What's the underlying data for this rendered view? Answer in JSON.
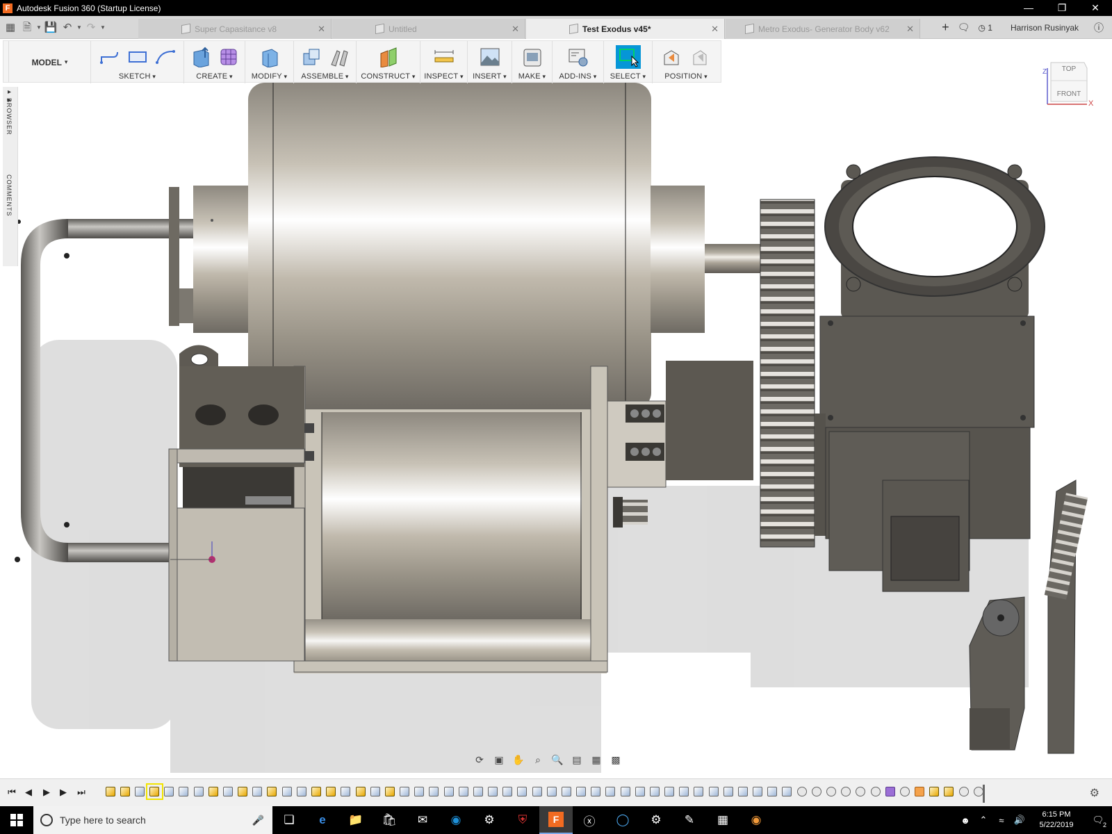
{
  "window": {
    "title": "Autodesk Fusion 360 (Startup License)",
    "icon_letter": "F"
  },
  "tabs": [
    {
      "label": "Super Capasitance v8",
      "active": false
    },
    {
      "label": "Untitled",
      "active": false
    },
    {
      "label": "Test Exodus v45*",
      "active": true
    },
    {
      "label": "Metro Exodus- Generator Body v62",
      "active": false
    }
  ],
  "header_right": {
    "job_count": "1",
    "user": "Harrison Rusinyak"
  },
  "toolbar": {
    "workspace": "MODEL",
    "groups": [
      "SKETCH",
      "CREATE",
      "MODIFY",
      "ASSEMBLE",
      "CONSTRUCT",
      "INSPECT",
      "INSERT",
      "MAKE",
      "ADD-INS",
      "SELECT",
      "POSITION"
    ]
  },
  "sidebar": {
    "browser_label": "BROWSER",
    "comments_label": "COMMENTS"
  },
  "viewcube": {
    "top": "TOP",
    "front": "FRONT",
    "axis_z": "Z",
    "axis_x": "X"
  },
  "taskbar": {
    "search_placeholder": "Type here to search",
    "time": "6:15 PM",
    "date": "5/22/2019",
    "notification_count": "2"
  },
  "colors": {
    "accent": "#0696d7",
    "title_bar": "#000000",
    "tab_bar": "#d8d8d8"
  }
}
